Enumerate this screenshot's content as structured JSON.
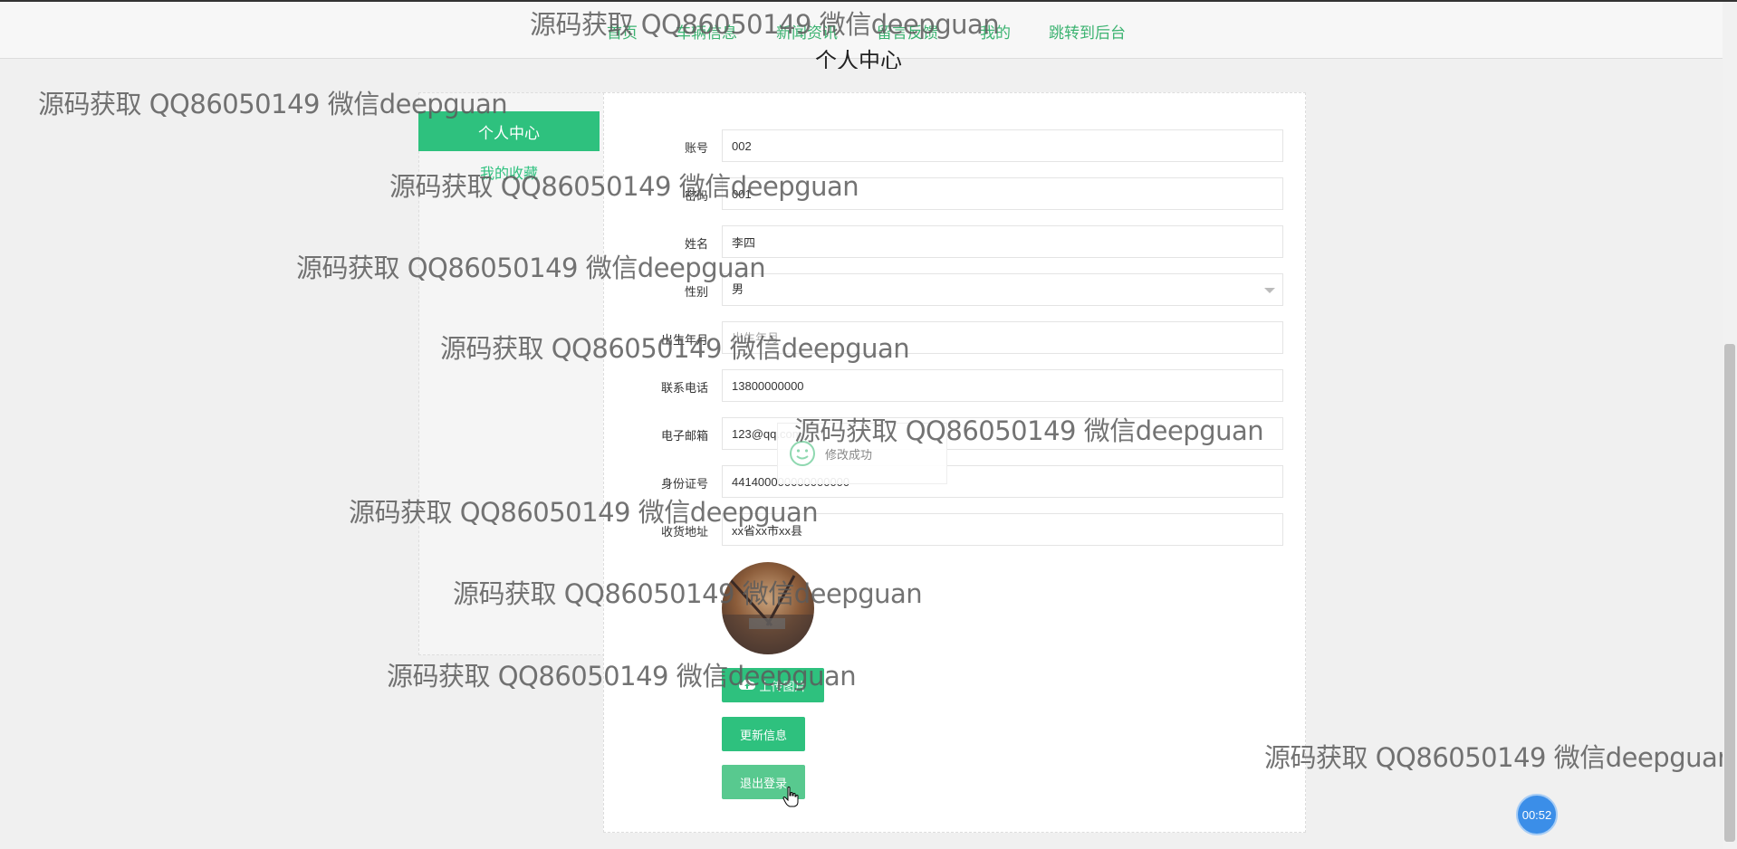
{
  "nav": {
    "items": [
      "首页",
      "车辆信息",
      "新闻资讯",
      "留言反馈",
      "我的",
      "跳转到后台"
    ]
  },
  "page_title": "个人中心",
  "sidebar": {
    "items": [
      "个人中心",
      "我的收藏"
    ]
  },
  "form": {
    "account_label": "账号",
    "account_value": "002",
    "password_label": "密码",
    "password_value": "001",
    "name_label": "姓名",
    "name_value": "李四",
    "gender_label": "性别",
    "gender_value": "男",
    "birth_label": "出生年月",
    "birth_placeholder": "出生年月",
    "phone_label": "联系电话",
    "phone_value": "13800000000",
    "email_label": "电子邮箱",
    "email_value": "123@qq.com",
    "id_label": "身份证号",
    "id_value": "441400000000000000",
    "address_label": "收货地址",
    "address_value": "xx省xx市xx县"
  },
  "buttons": {
    "upload": "上传图片",
    "update": "更新信息",
    "logout": "退出登录"
  },
  "toast": {
    "message": "修改成功"
  },
  "timer": {
    "text": "00:52"
  },
  "watermark": "源码获取 QQ86050149 微信deepguan",
  "colors": {
    "accent": "#2ec17e",
    "nav_link": "#3cb371",
    "timer": "#3b8ee8"
  }
}
